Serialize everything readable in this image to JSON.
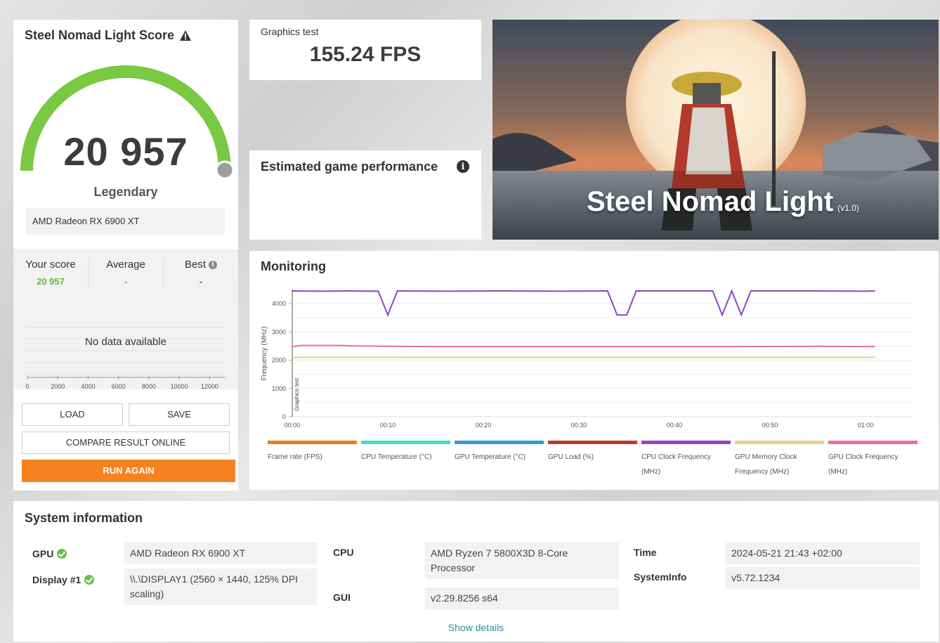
{
  "score_panel": {
    "title": "Steel Nomad Light Score",
    "score": "20 957",
    "rating": "Legendary",
    "gauge_fraction": 1.0,
    "gpu": "AMD Radeon RX 6900 XT",
    "compare": {
      "your_label": "Your score",
      "your_value": "20 957",
      "avg_label": "Average",
      "avg_value": "-",
      "best_label": "Best",
      "best_value": "-"
    },
    "no_data": "No data available",
    "hist_ticks": [
      "0",
      "2000",
      "4000",
      "6000",
      "8000",
      "10000",
      "12000"
    ],
    "load": "LOAD",
    "save": "SAVE",
    "compare_online": "COMPARE RESULT ONLINE",
    "run_again": "RUN AGAIN"
  },
  "graphics_test": {
    "label": "Graphics test",
    "value": "155.24 FPS"
  },
  "estimated": {
    "label": "Estimated game performance"
  },
  "banner": {
    "title": "Steel Nomad Light",
    "version": "(v1.0)"
  },
  "monitoring": {
    "title": "Monitoring",
    "y_label": "Frequency (MHz)",
    "marker_label": "Graphics test",
    "chart_data": {
      "type": "line",
      "x_ticks": [
        "00:00",
        "00:10",
        "00:20",
        "00:30",
        "00:40",
        "00:50",
        "01:00"
      ],
      "y_ticks": [
        "0",
        "1000",
        "2000",
        "3000",
        "4000"
      ],
      "ylim": [
        0,
        4500
      ],
      "xlim_seconds": [
        0,
        65
      ],
      "series": [
        {
          "name": "CPU Clock Frequency (MHz)",
          "color": "#8e44c8",
          "points": [
            [
              0,
              4450
            ],
            [
              3,
              4440
            ],
            [
              6,
              4450
            ],
            [
              9,
              4440
            ],
            [
              10,
              3600
            ],
            [
              11,
              4450
            ],
            [
              16,
              4440
            ],
            [
              22,
              4450
            ],
            [
              28,
              4440
            ],
            [
              33,
              4450
            ],
            [
              34,
              3600
            ],
            [
              35,
              3600
            ],
            [
              36,
              4450
            ],
            [
              42,
              4450
            ],
            [
              44,
              4450
            ],
            [
              45,
              3600
            ],
            [
              46,
              4450
            ],
            [
              47,
              3600
            ],
            [
              48,
              4450
            ],
            [
              54,
              4450
            ],
            [
              60,
              4440
            ],
            [
              61,
              4450
            ]
          ]
        },
        {
          "name": "GPU Clock Frequency (MHz)",
          "color": "#e8709a",
          "points": [
            [
              0,
              2480
            ],
            [
              1,
              2520
            ],
            [
              5,
              2520
            ],
            [
              7,
              2500
            ],
            [
              15,
              2480
            ],
            [
              30,
              2480
            ],
            [
              45,
              2480
            ],
            [
              55,
              2490
            ],
            [
              61,
              2480
            ]
          ]
        },
        {
          "name": "GPU Memory Clock Frequency (MHz)",
          "color": "#e6d08a",
          "points": [
            [
              0,
              2100
            ],
            [
              30,
              2100
            ],
            [
              61,
              2100
            ]
          ]
        }
      ]
    },
    "legend": [
      {
        "label": "Frame rate (FPS)",
        "color": "#e67e22"
      },
      {
        "label": "CPU Temperature (°C)",
        "color": "#40e0c0"
      },
      {
        "label": "GPU Temperature (°C)",
        "color": "#3498db"
      },
      {
        "label": "GPU Load (%)",
        "color": "#c0392b"
      },
      {
        "label": "CPU Clock Frequency (MHz)",
        "color": "#8e44c8"
      },
      {
        "label": "GPU Memory Clock Frequency (MHz)",
        "color": "#e6d08a"
      },
      {
        "label": "GPU Clock Frequency (MHz)",
        "color": "#e8709a"
      }
    ]
  },
  "system": {
    "title": "System information",
    "gpu_key": "GPU",
    "gpu_val": "AMD Radeon RX 6900 XT",
    "display_key": "Display #1",
    "display_val": "\\\\.\\DISPLAY1 (2560 × 1440, 125% DPI scaling)",
    "cpu_key": "CPU",
    "cpu_val": "AMD Ryzen 7 5800X3D 8-Core Processor",
    "gui_key": "GUI",
    "gui_val": "v2.29.8256 s64",
    "time_key": "Time",
    "time_val": "2024-05-21 21:43 +02:00",
    "sysinfo_key": "SystemInfo",
    "sysinfo_val": "v5.72.1234",
    "show_details": "Show details"
  },
  "colors": {
    "gauge": "#7ac943",
    "accent_orange": "#f5821f",
    "score_green": "#6cb33f",
    "link": "#2a8fa3"
  }
}
